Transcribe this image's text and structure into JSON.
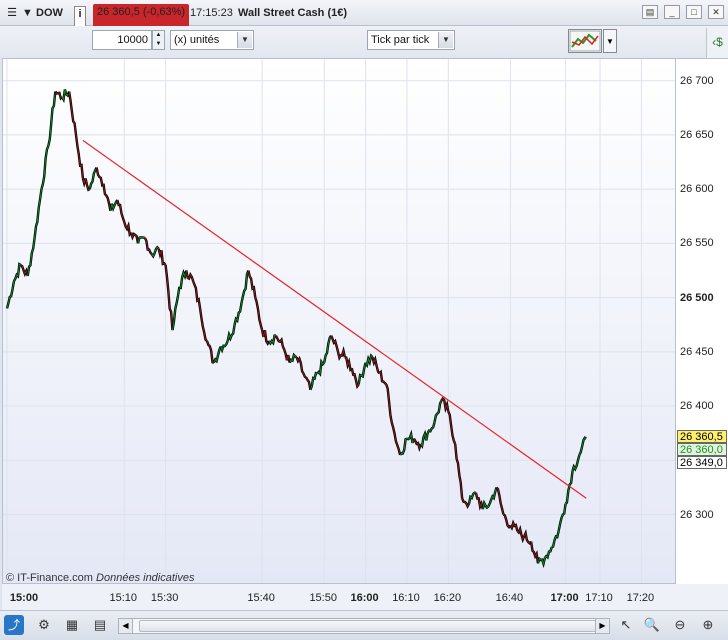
{
  "titlebar": {
    "symbol": "DOW",
    "info": "i",
    "price_change": "26 360,5 (-0,63%)",
    "time": "17:15:23",
    "instrument": "Wall Street Cash (1€)",
    "menu_icon": "menu-icon",
    "win_buttons": [
      "restore",
      "minimize",
      "maximize",
      "close"
    ]
  },
  "toolbar": {
    "quantity": "10000",
    "unit": "(x) unités",
    "interval": "Tick par tick"
  },
  "chart": {
    "copyright": "© IT-Finance.com",
    "copyright_note": "Données indicatives",
    "trendline_color": "#e8222a",
    "up_color": "#0a8a2a",
    "down_color": "#8a1a1a",
    "price_labels": [
      {
        "text": "26 360,5",
        "bg": "#ffef6a"
      },
      {
        "text": "26 360,0",
        "bg": "#dff5dc"
      },
      {
        "text": "26 349,0",
        "bg": "#ffffff"
      }
    ]
  },
  "chart_data": {
    "type": "line",
    "title": "",
    "ylim": [
      26235,
      26720
    ],
    "yticks": [
      "26 700",
      "26 650",
      "26 600",
      "26 550",
      "26 500",
      "26 450",
      "26 400",
      "26 350",
      "26 300"
    ],
    "ytick_values": [
      26700,
      26650,
      26600,
      26550,
      26500,
      26450,
      26400,
      26350,
      26300
    ],
    "xticks": [
      "15:00",
      "15:10",
      "15:30",
      "15:40",
      "15:50",
      "16:00",
      "16:10",
      "16:20",
      "16:40",
      "17:00",
      "17:10",
      "17:20"
    ],
    "xtick_idx": [
      0,
      17,
      23,
      37,
      46,
      52,
      58,
      64,
      73,
      81,
      86,
      92
    ],
    "bold_xticks": [
      "15:00",
      "16:00",
      "17:00"
    ],
    "series": [
      {
        "values": [
          26490,
          26515,
          26530,
          26520,
          26555,
          26600,
          26640,
          26690,
          26685,
          26690,
          26650,
          26610,
          26600,
          26620,
          26605,
          26580,
          26590,
          26570,
          26560,
          26550,
          26555,
          26540,
          26545,
          26530,
          26470,
          26510,
          26525,
          26515,
          26490,
          26460,
          26440,
          26455,
          26460,
          26475,
          26495,
          26525,
          26500,
          26470,
          26460,
          26465,
          26455,
          26440,
          26445,
          26430,
          26415,
          26430,
          26440,
          26465,
          26450,
          26445,
          26435,
          26420,
          26440,
          26445,
          26430,
          26420,
          26380,
          26355,
          26370,
          26370,
          26365,
          26375,
          26385,
          26405,
          26395,
          26365,
          26315,
          26310,
          26320,
          26305,
          26310,
          26325,
          26300,
          26290,
          26285,
          26280,
          26275,
          26255,
          26260,
          26270,
          26285,
          26310,
          26340,
          26355,
          26370
        ]
      }
    ],
    "trendline": {
      "from": {
        "idx": 11,
        "value": 26645
      },
      "to": {
        "idx": 84,
        "value": 26315
      }
    }
  }
}
